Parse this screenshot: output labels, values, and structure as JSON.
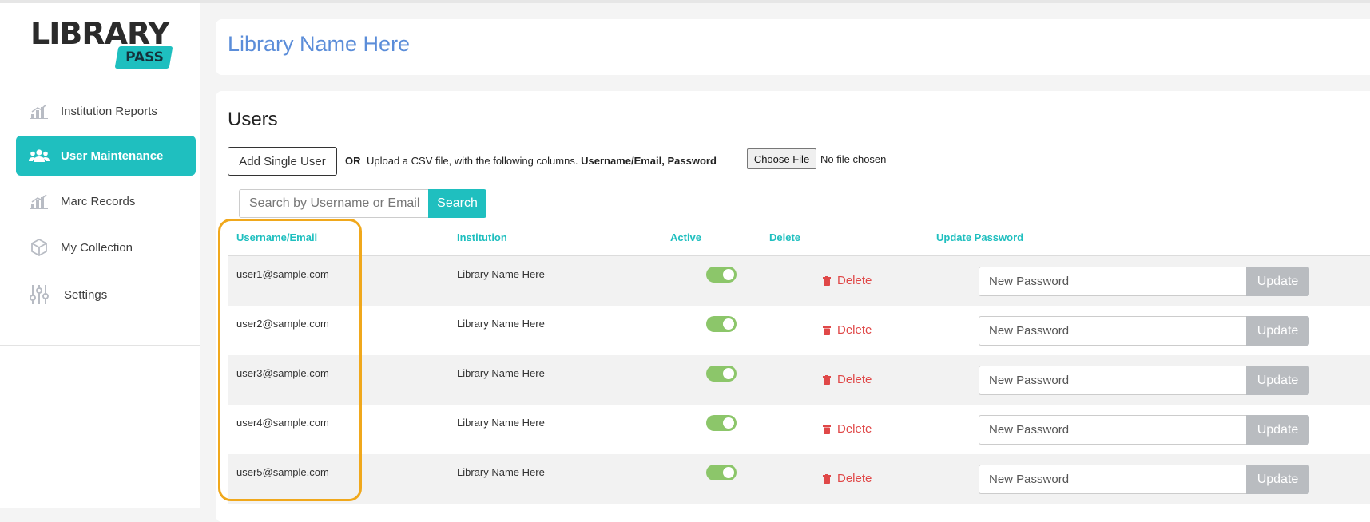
{
  "logo": {
    "word": "LIBRARY",
    "badge": "PASS"
  },
  "sidebar": {
    "items": [
      {
        "label": "Institution Reports",
        "icon": "bar-chart-icon",
        "active": false
      },
      {
        "label": "User Maintenance",
        "icon": "users-icon",
        "active": true
      },
      {
        "label": "Marc Records",
        "icon": "bar-chart-icon",
        "active": false
      },
      {
        "label": "My Collection",
        "icon": "box-icon",
        "active": false
      },
      {
        "label": "Settings",
        "icon": "sliders-icon",
        "active": false
      }
    ]
  },
  "header": {
    "title": "Library Name Here"
  },
  "users": {
    "title": "Users",
    "add_label": "Add Single User",
    "or_label": "OR",
    "csv_prefix": "Upload a CSV file, with the following columns.",
    "csv_columns": "Username/Email, Password",
    "choose_label": "Choose File",
    "no_file_label": "No file chosen",
    "search_placeholder": "Search by Username or Email",
    "search_label": "Search",
    "columns": [
      "Username/Email",
      "Institution",
      "Active",
      "Delete",
      "Update Password"
    ],
    "rows": [
      {
        "email": "user1@sample.com",
        "institution": "Library Name Here",
        "active": true
      },
      {
        "email": "user2@sample.com",
        "institution": "Library Name Here",
        "active": true
      },
      {
        "email": "user3@sample.com",
        "institution": "Library Name Here",
        "active": true
      },
      {
        "email": "user4@sample.com",
        "institution": "Library Name Here",
        "active": true
      },
      {
        "email": "user5@sample.com",
        "institution": "Library Name Here",
        "active": true
      }
    ],
    "delete_label": "Delete",
    "password_placeholder": "New Password",
    "update_label": "Update"
  },
  "colors": {
    "accent": "#1fbfbf",
    "title_blue": "#5b8dd9",
    "delete_red": "#e04848",
    "toggle_on": "#8cc66a",
    "highlight": "#f0a81c",
    "update_btn": "#b9bcc0"
  }
}
